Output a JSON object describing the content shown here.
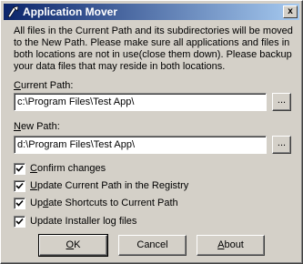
{
  "window": {
    "title": "Application Mover",
    "close_glyph": "x",
    "icon": "app-mover-icon"
  },
  "description": "All files in the Current Path and its subdirectories will be moved to the New Path.  Please make sure all applications and files in both locations are not in use(close them down).  Please backup your data files that may reside in both locations.",
  "current_path": {
    "label_first": "C",
    "label_rest": "urrent Path:",
    "value": "c:\\Program Files\\Test App\\",
    "browse_label": "..."
  },
  "new_path": {
    "label_first": "N",
    "label_rest": "ew Path:",
    "value": "d:\\Program Files\\Test App\\",
    "browse_label": "..."
  },
  "options": [
    {
      "pre": "",
      "u": "C",
      "post": "onfirm changes",
      "checked": true
    },
    {
      "pre": "",
      "u": "U",
      "post": "pdate Current Path in the Registry",
      "checked": true
    },
    {
      "pre": "Up",
      "u": "d",
      "post": "ate Shortcuts to Current Path",
      "checked": true
    },
    {
      "pre": "Update Installer log files",
      "u": "",
      "post": "",
      "checked": true
    }
  ],
  "buttons": {
    "ok": {
      "u": "O",
      "post": "K"
    },
    "cancel": {
      "label": "Cancel"
    },
    "about": {
      "u": "A",
      "post": "bout"
    }
  }
}
